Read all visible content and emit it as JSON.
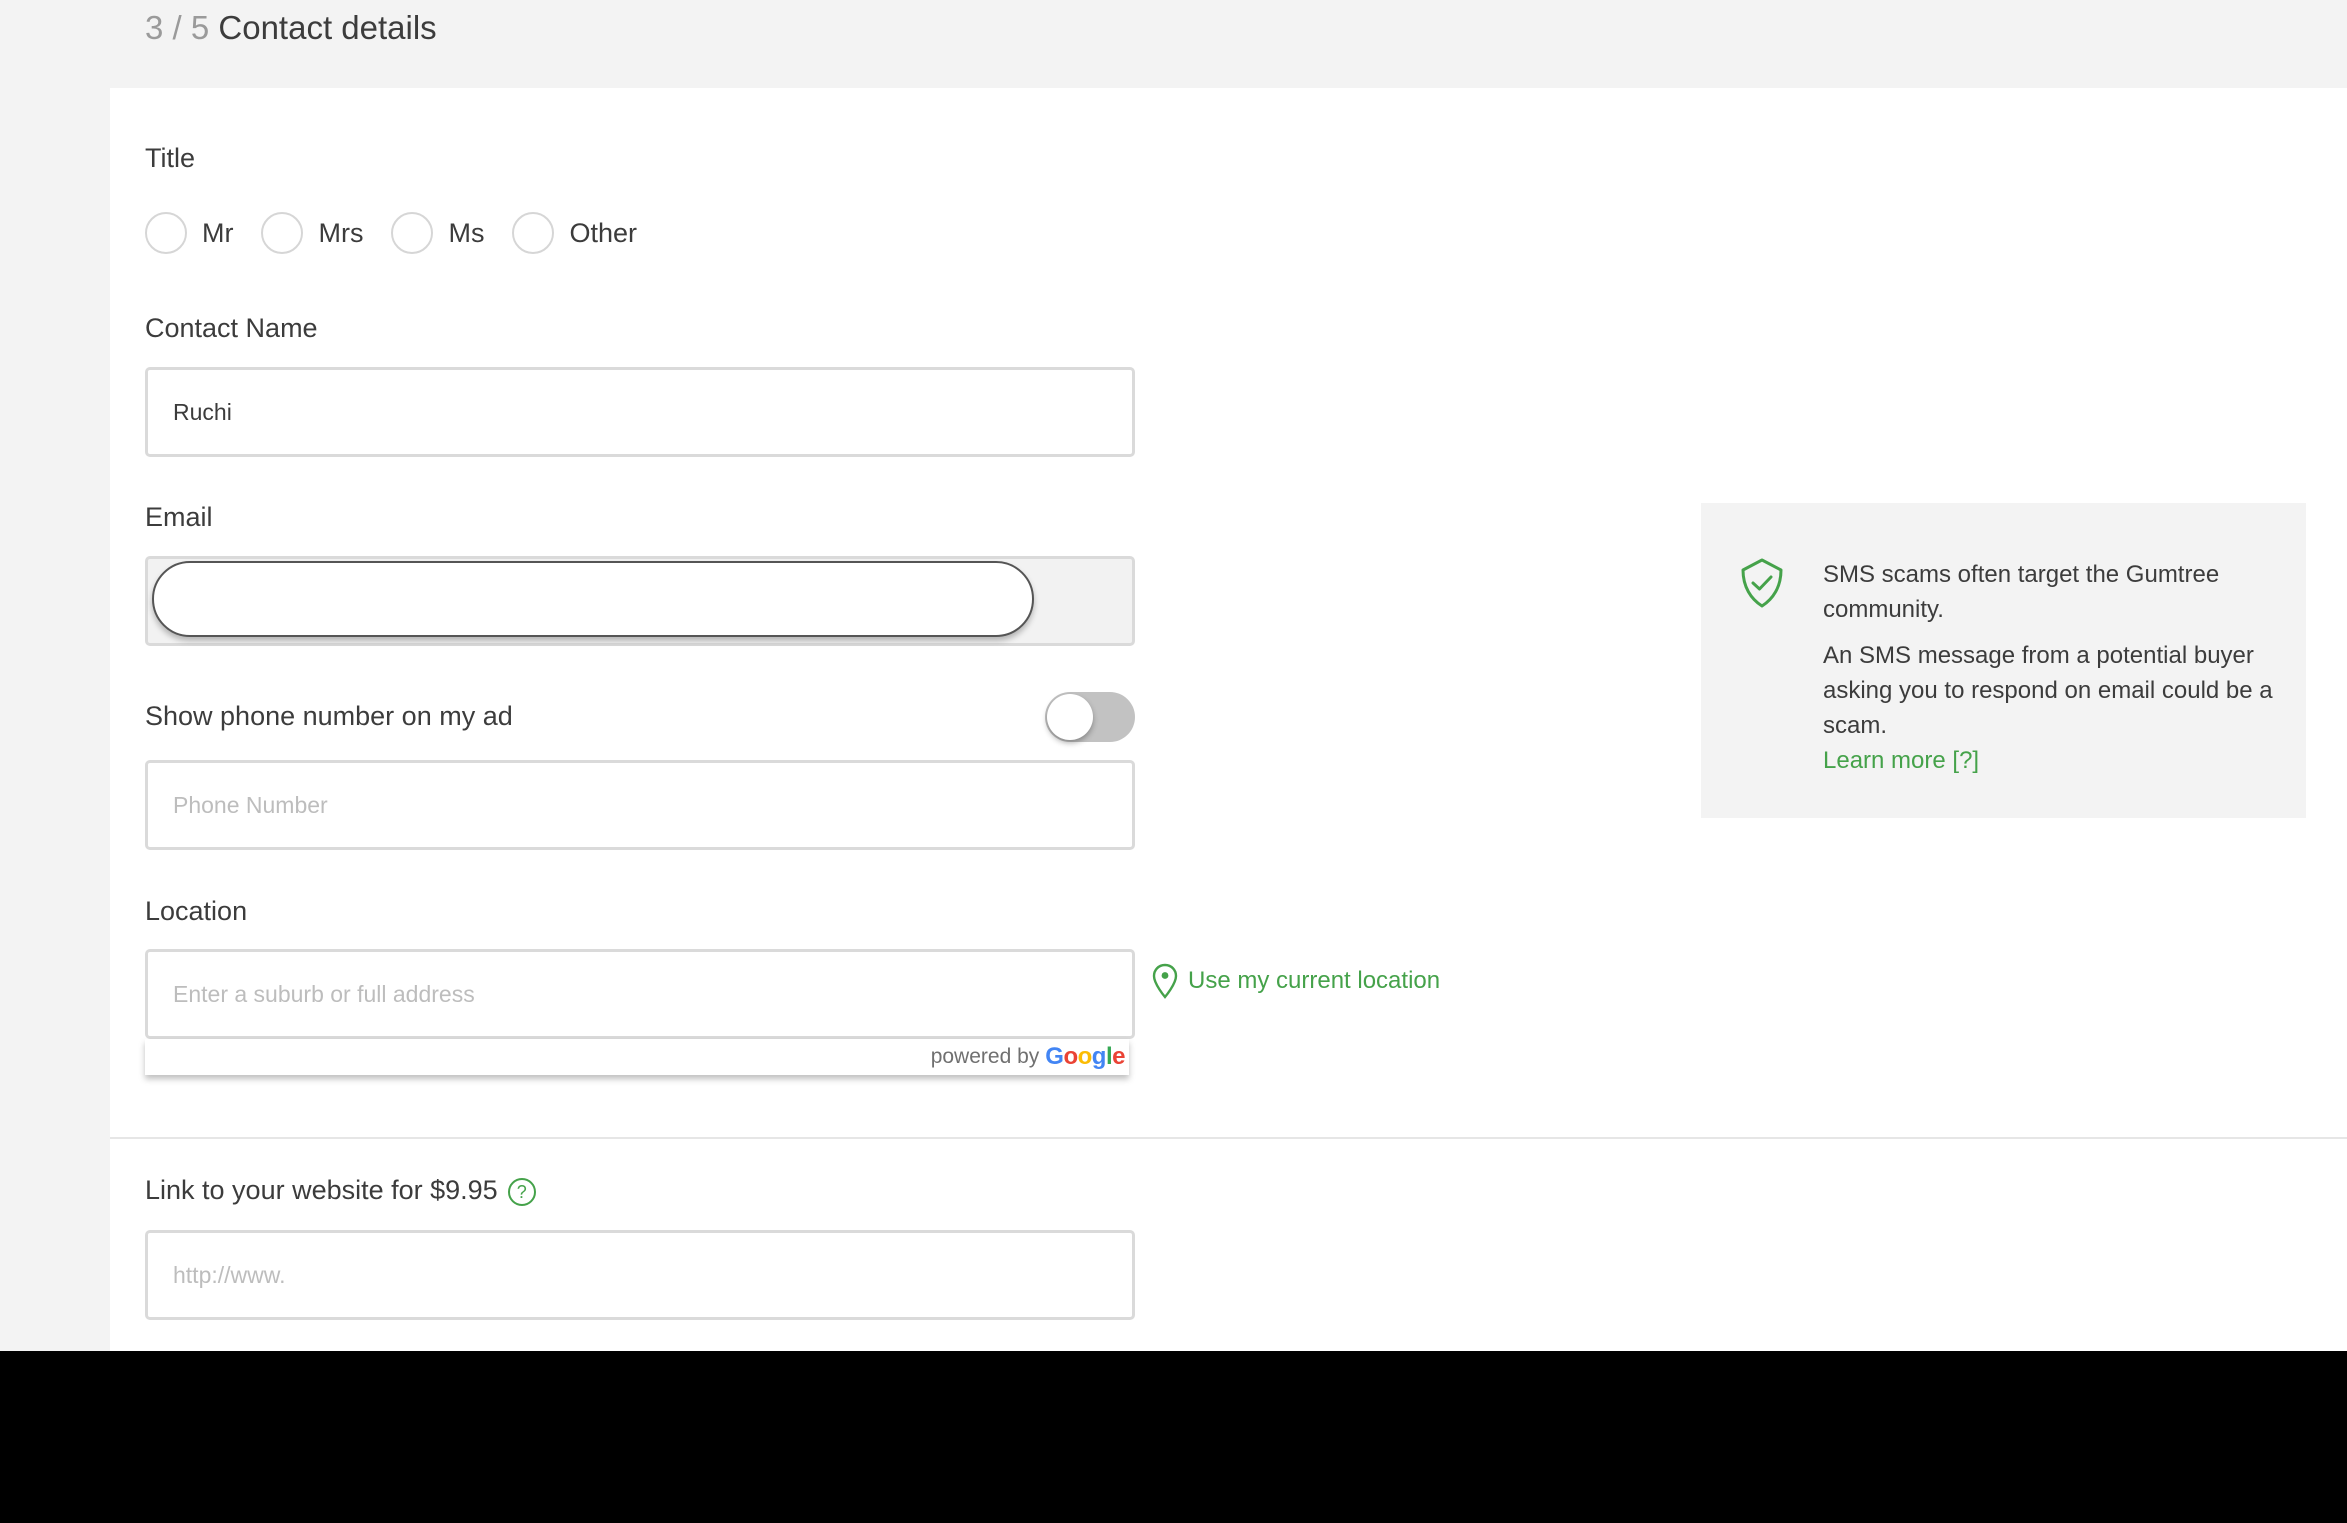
{
  "header": {
    "step_number": "3 / 5",
    "step_title": "Contact details"
  },
  "form": {
    "title_field": {
      "label": "Title",
      "options": [
        "Mr",
        "Mrs",
        "Ms",
        "Other"
      ],
      "selected": null
    },
    "contact_name": {
      "label": "Contact Name",
      "value": "Ruchi"
    },
    "email": {
      "label": "Email",
      "value": ""
    },
    "phone_toggle": {
      "label": "Show phone number on my ad",
      "enabled": false
    },
    "phone": {
      "placeholder": "Phone Number",
      "value": ""
    },
    "location": {
      "label": "Location",
      "placeholder": "Enter a suburb or full address",
      "value": "",
      "use_current_location": "Use my current location",
      "powered_by": "powered by",
      "google_letters": [
        {
          "ch": "G",
          "color": "#4285F4"
        },
        {
          "ch": "o",
          "color": "#EA4335"
        },
        {
          "ch": "o",
          "color": "#FBBC05"
        },
        {
          "ch": "g",
          "color": "#4285F4"
        },
        {
          "ch": "l",
          "color": "#34A853"
        },
        {
          "ch": "e",
          "color": "#EA4335"
        }
      ]
    },
    "website": {
      "label": "Link to your website for $9.95",
      "help_icon": "?",
      "placeholder": "http://www.",
      "value": ""
    }
  },
  "tip": {
    "icon": "shield-check-icon",
    "heading": "SMS scams often target the Gumtree community.",
    "body": "An SMS message from a potential buyer asking you to respond on email could be a scam.",
    "link": "Learn more [?]"
  },
  "colors": {
    "accent_green": "#45a24a",
    "page_bg": "#f3f3f3",
    "border": "#dadada"
  }
}
